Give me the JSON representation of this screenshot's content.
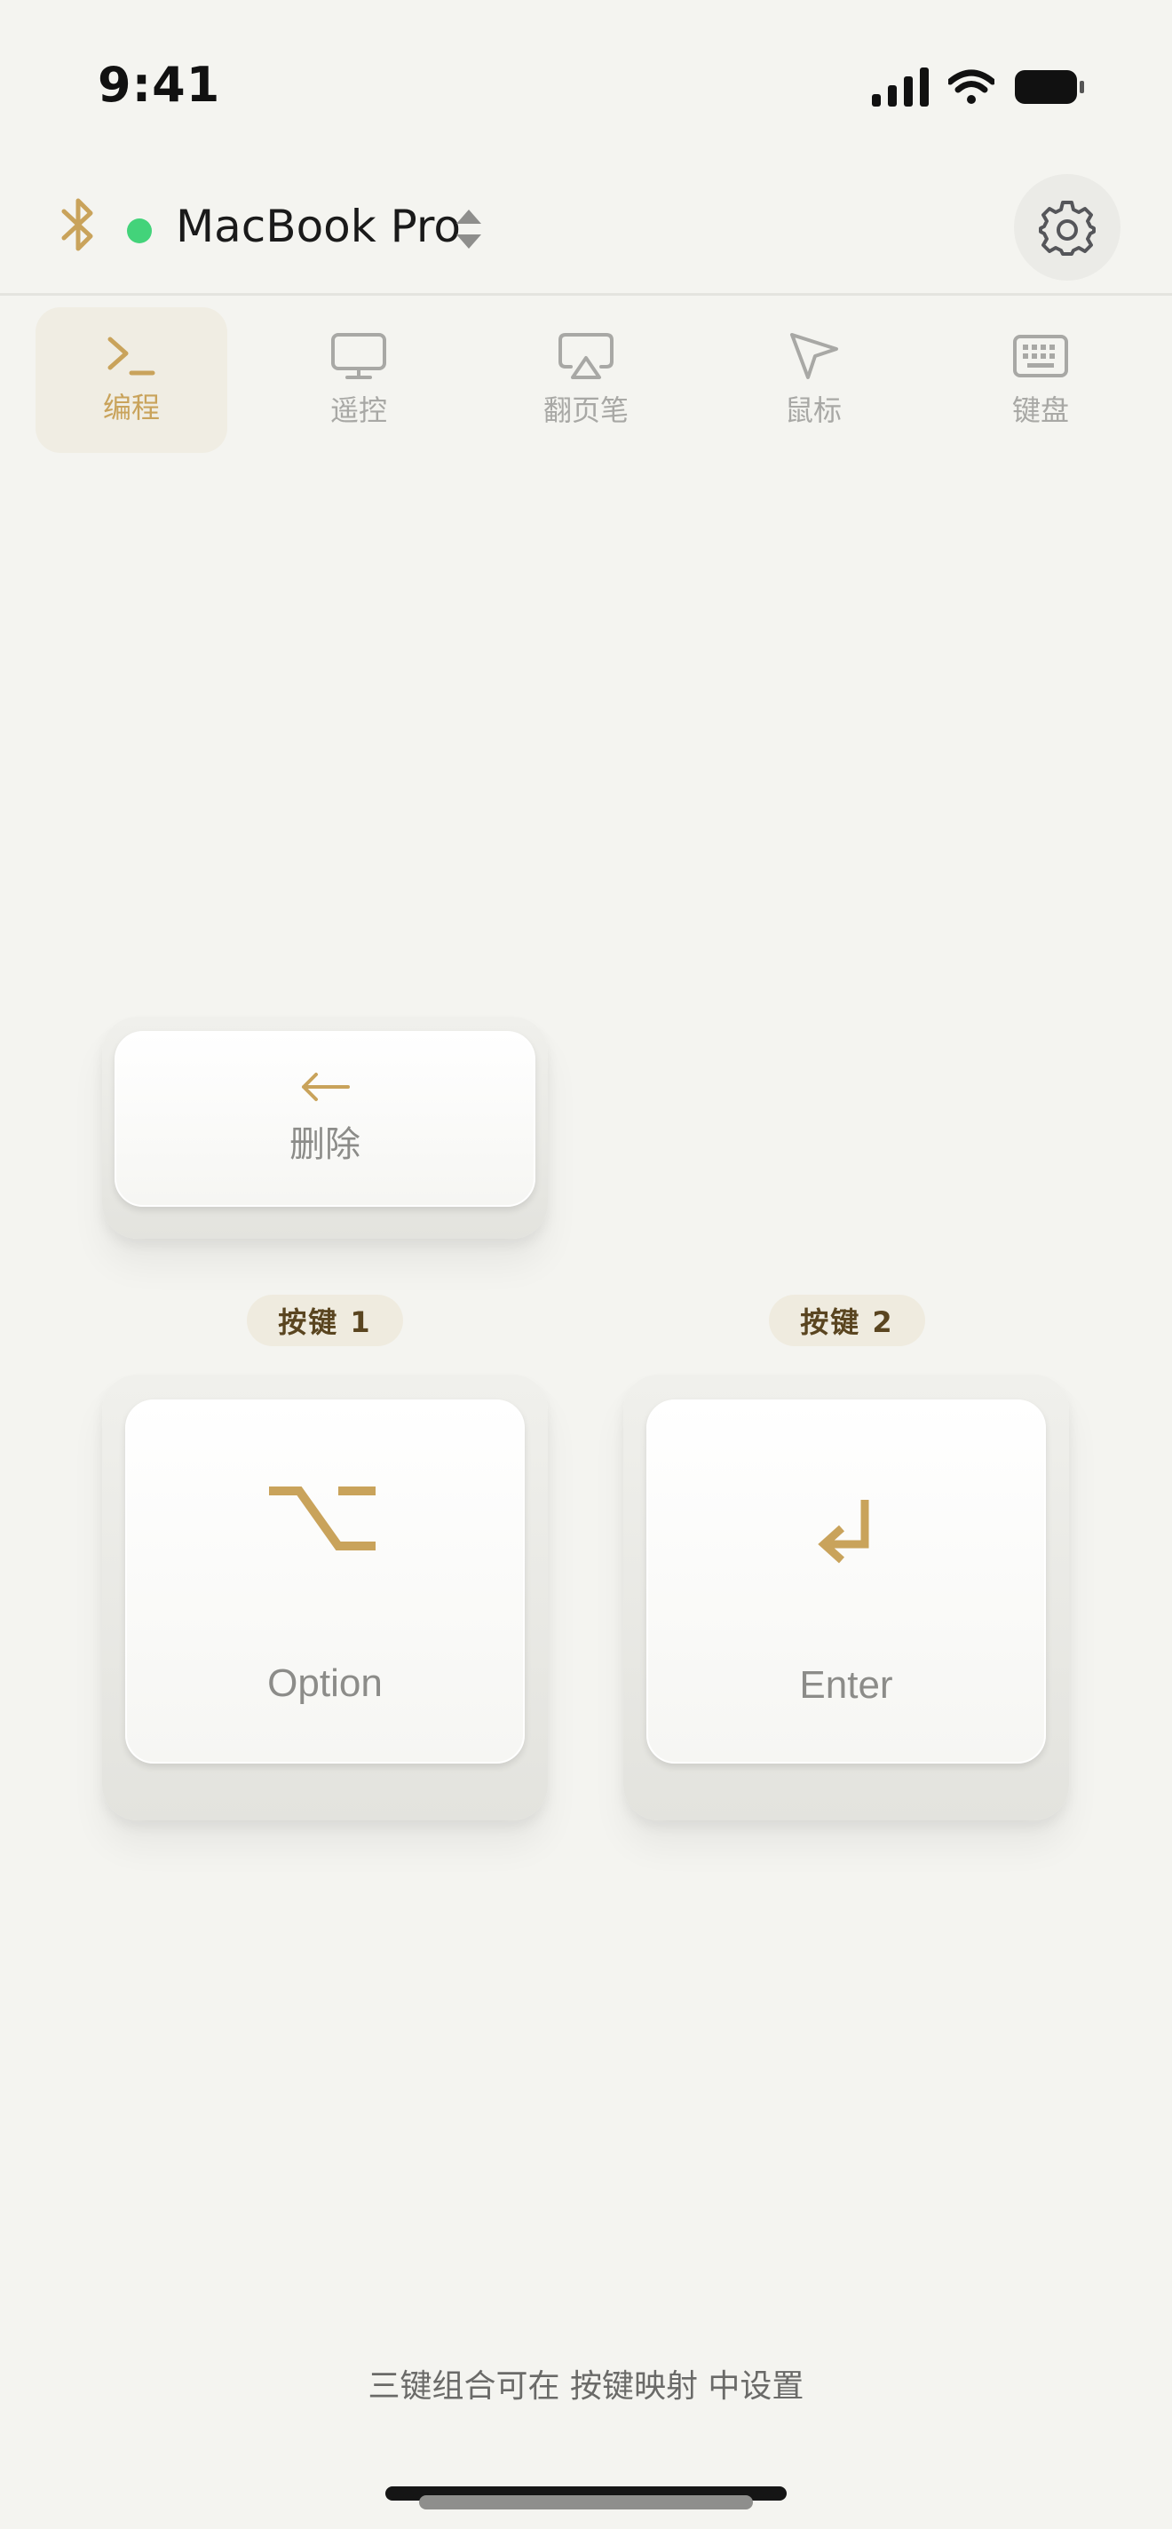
{
  "status_bar": {
    "time": "9:41"
  },
  "header": {
    "device_name": "MacBook Pro",
    "connected_color": "#43d37a",
    "accent_color": "#c9a35b"
  },
  "tabs": [
    {
      "label": "编程",
      "icon": "terminal-icon",
      "active": true
    },
    {
      "label": "遥控",
      "icon": "monitor-icon",
      "active": false
    },
    {
      "label": "翻页笔",
      "icon": "airplay-icon",
      "active": false
    },
    {
      "label": "鼠标",
      "icon": "pointer-icon",
      "active": false
    },
    {
      "label": "键盘",
      "icon": "keyboard-icon",
      "active": false
    }
  ],
  "keys": {
    "delete": {
      "label": "删除",
      "icon": "arrow-left-icon"
    },
    "slot1_badge": "按键 1",
    "slot2_badge": "按键 2",
    "option": {
      "label": "Option",
      "icon": "option-icon"
    },
    "enter": {
      "label": "Enter",
      "icon": "return-icon"
    }
  },
  "footer": {
    "hint": "三键组合可在 按键映射 中设置"
  }
}
